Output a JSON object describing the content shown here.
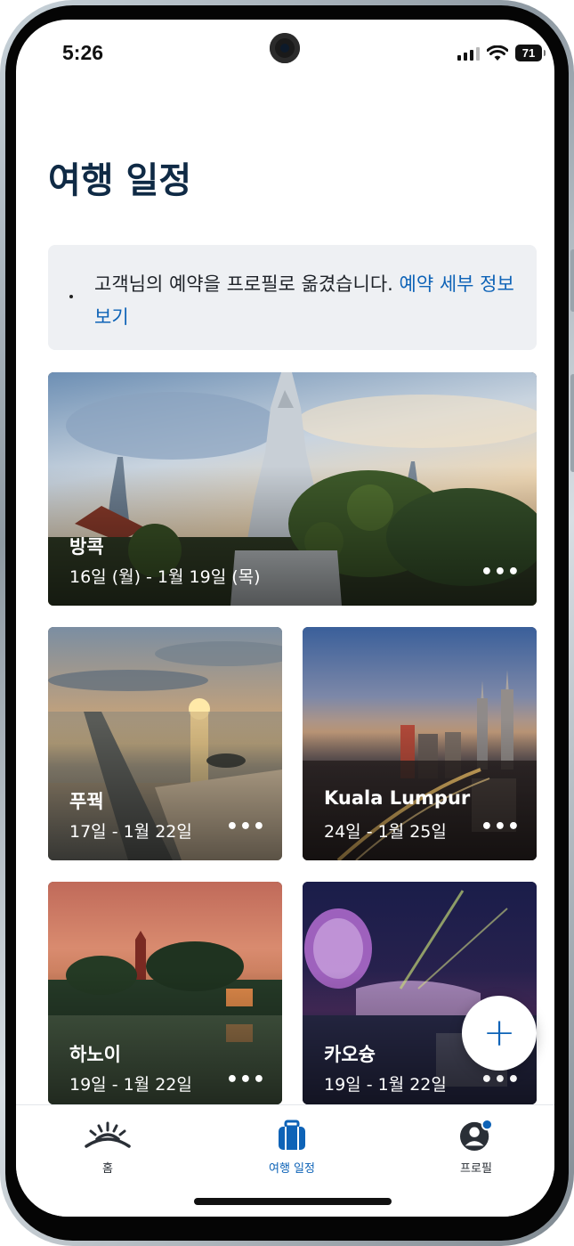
{
  "status_bar": {
    "time": "5:26",
    "battery": "71"
  },
  "page": {
    "title": "여행 일정"
  },
  "notice": {
    "text": "고객님의 예약을 프로필로 옮겼습니다. ",
    "link": "예약 세부 정보 보기"
  },
  "trips": [
    {
      "city": "방콕",
      "dates": "16일 (월) - 1월 19일 (목)",
      "more": "•••"
    },
    {
      "city": "푸꿕",
      "dates": "17일 - 1월 22일",
      "more": "•••"
    },
    {
      "city": "Kuala Lumpur",
      "dates": "24일 - 1월 25일",
      "more": "•••"
    },
    {
      "city": "하노이",
      "dates": "19일 - 1월 22일",
      "more": "•••"
    },
    {
      "city": "카오슝",
      "dates": "19일 - 1월 22일",
      "more": "•••"
    }
  ],
  "fab": {
    "label": "+"
  },
  "bottom_nav": [
    {
      "label": "홈",
      "icon": "sunrise-icon",
      "active": false
    },
    {
      "label": "여행 일정",
      "icon": "luggage-icon",
      "active": true
    },
    {
      "label": "프로필",
      "icon": "profile-icon",
      "active": false
    }
  ],
  "colors": {
    "title": "#0f2a45",
    "link": "#0e63b7",
    "notice_bg": "#eef0f3"
  }
}
